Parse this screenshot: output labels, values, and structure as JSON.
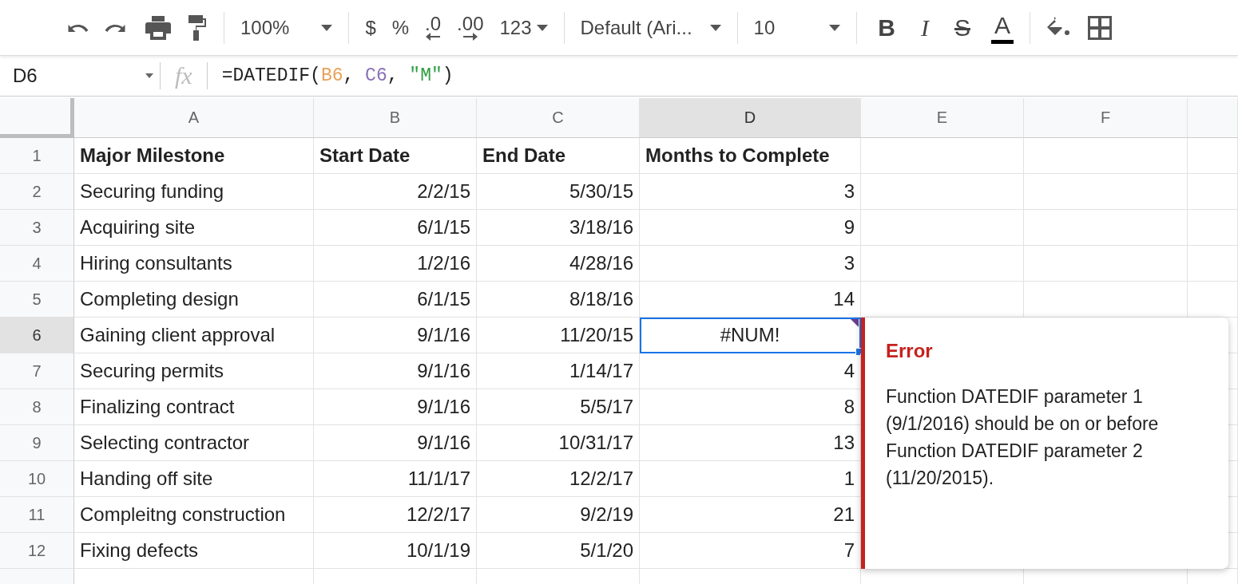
{
  "toolbar": {
    "zoom": "100%",
    "currency": "$",
    "percent": "%",
    "decrease_decimals": ".0",
    "increase_decimals": ".00",
    "number_format": "123",
    "font": "Default (Ari...",
    "font_size": "10",
    "bold": "B",
    "italic": "I",
    "strikethrough": "S",
    "text_color": "A"
  },
  "formula_bar": {
    "cell_reference": "D6",
    "fx": "fx",
    "formula": [
      {
        "text": "=DATEDIF(",
        "color": "#222222"
      },
      {
        "text": "B6",
        "color": "#e8a25a"
      },
      {
        "text": ", ",
        "color": "#222222"
      },
      {
        "text": "C6",
        "color": "#8a6fb8"
      },
      {
        "text": ", ",
        "color": "#222222"
      },
      {
        "text": "\"M\"",
        "color": "#2f9e44"
      },
      {
        "text": ")",
        "color": "#222222"
      }
    ]
  },
  "sheet": {
    "columns": [
      {
        "label": "A",
        "selected": false
      },
      {
        "label": "B",
        "selected": false
      },
      {
        "label": "C",
        "selected": false
      },
      {
        "label": "D",
        "selected": true
      },
      {
        "label": "E",
        "selected": false
      },
      {
        "label": "F",
        "selected": false
      }
    ],
    "rows": [
      {
        "label": "1",
        "selected": false,
        "kind": "header",
        "error": false,
        "cells": [
          "Major Milestone",
          "Start Date",
          "End Date",
          "Months to Complete"
        ]
      },
      {
        "label": "2",
        "selected": false,
        "kind": "data",
        "error": false,
        "cells": [
          "Securing funding",
          "2/2/15",
          "5/30/15",
          "3"
        ]
      },
      {
        "label": "3",
        "selected": false,
        "kind": "data",
        "error": false,
        "cells": [
          "Acquiring site",
          "6/1/15",
          "3/18/16",
          "9"
        ]
      },
      {
        "label": "4",
        "selected": false,
        "kind": "data",
        "error": false,
        "cells": [
          "Hiring consultants",
          "1/2/16",
          "4/28/16",
          "3"
        ]
      },
      {
        "label": "5",
        "selected": false,
        "kind": "data",
        "error": false,
        "cells": [
          "Completing design",
          "6/1/15",
          "8/18/16",
          "14"
        ]
      },
      {
        "label": "6",
        "selected": true,
        "kind": "data",
        "error": true,
        "cells": [
          "Gaining client approval",
          "9/1/16",
          "11/20/15",
          "#NUM!"
        ]
      },
      {
        "label": "7",
        "selected": false,
        "kind": "data",
        "error": false,
        "cells": [
          "Securing permits",
          "9/1/16",
          "1/14/17",
          "4"
        ]
      },
      {
        "label": "8",
        "selected": false,
        "kind": "data",
        "error": false,
        "cells": [
          "Finalizing contract",
          "9/1/16",
          "5/5/17",
          "8"
        ]
      },
      {
        "label": "9",
        "selected": false,
        "kind": "data",
        "error": false,
        "cells": [
          "Selecting contractor",
          "9/1/16",
          "10/31/17",
          "13"
        ]
      },
      {
        "label": "10",
        "selected": false,
        "kind": "data",
        "error": false,
        "cells": [
          "Handing off site",
          "11/1/17",
          "12/2/17",
          "1"
        ]
      },
      {
        "label": "11",
        "selected": false,
        "kind": "data",
        "error": false,
        "cells": [
          "Compleitng construction",
          "12/2/17",
          "9/2/19",
          "21"
        ]
      },
      {
        "label": "12",
        "selected": false,
        "kind": "data",
        "error": false,
        "cells": [
          "Fixing defects",
          "10/1/19",
          "5/1/20",
          "7"
        ]
      }
    ]
  },
  "error_tooltip": {
    "title": "Error",
    "message": "Function DATEDIF parameter 1 (9/1/2016) should be on or before Function DATEDIF parameter 2 (11/20/2015)."
  }
}
